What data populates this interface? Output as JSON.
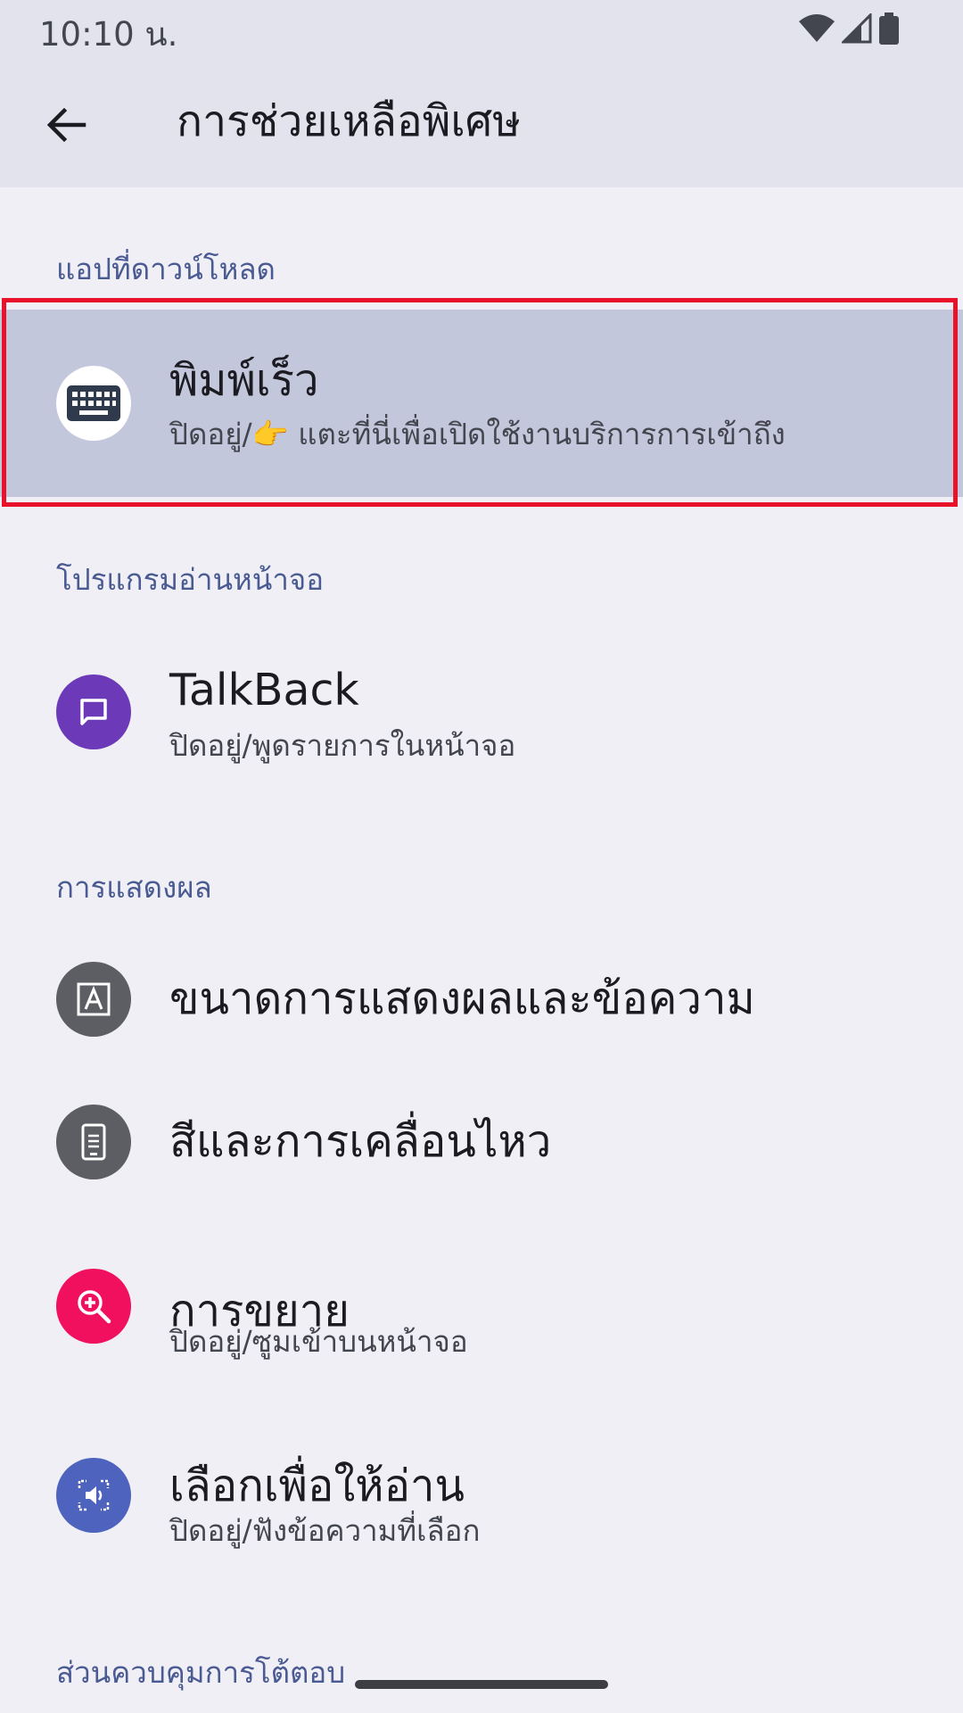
{
  "status_bar": {
    "time": "10:10 น."
  },
  "app_bar": {
    "title": "การช่วยเหลือพิเศษ"
  },
  "sections": {
    "downloaded": {
      "header": "แอปที่ดาวน์โหลด",
      "item": {
        "title": "พิมพ์เร็ว",
        "subtitle": "ปิดอยู่/👉 แตะที่นี่เพื่อเปิดใช้งานบริการการเข้าถึง",
        "icon": "keyboard-icon",
        "icon_color": "#ffffff"
      }
    },
    "screen_reader": {
      "header": "โปรแกรมอ่านหน้าจอ",
      "item": {
        "title": "TalkBack",
        "subtitle": "ปิดอยู่/พูดรายการในหน้าจอ",
        "icon": "chat-bubble-icon",
        "icon_color": "#6c3ab8"
      }
    },
    "display": {
      "header": "การแสดงผล",
      "items": [
        {
          "title": "ขนาดการแสดงผลและข้อความ",
          "icon": "text-size-icon",
          "icon_color": "#5d5e63"
        },
        {
          "title": "สีและการเคลื่อนไหว",
          "icon": "phone-icon",
          "icon_color": "#5d5e63"
        },
        {
          "title": "การขยาย",
          "subtitle": "ปิดอยู่/ซูมเข้าบนหน้าจอ",
          "icon": "magnify-icon",
          "icon_color": "#f0105e"
        },
        {
          "title": "เลือกเพื่อให้อ่าน",
          "subtitle": "ปิดอยู่/ฟังข้อความที่เลือก",
          "icon": "select-to-speak-icon",
          "icon_color": "#4d63be"
        }
      ]
    },
    "interaction": {
      "header": "ส่วนควบคุมการโต้ตอบ"
    }
  },
  "colors": {
    "highlight_bg": "#c3c7db",
    "highlight_border": "#e8132b",
    "section_header": "#4a5a92"
  }
}
